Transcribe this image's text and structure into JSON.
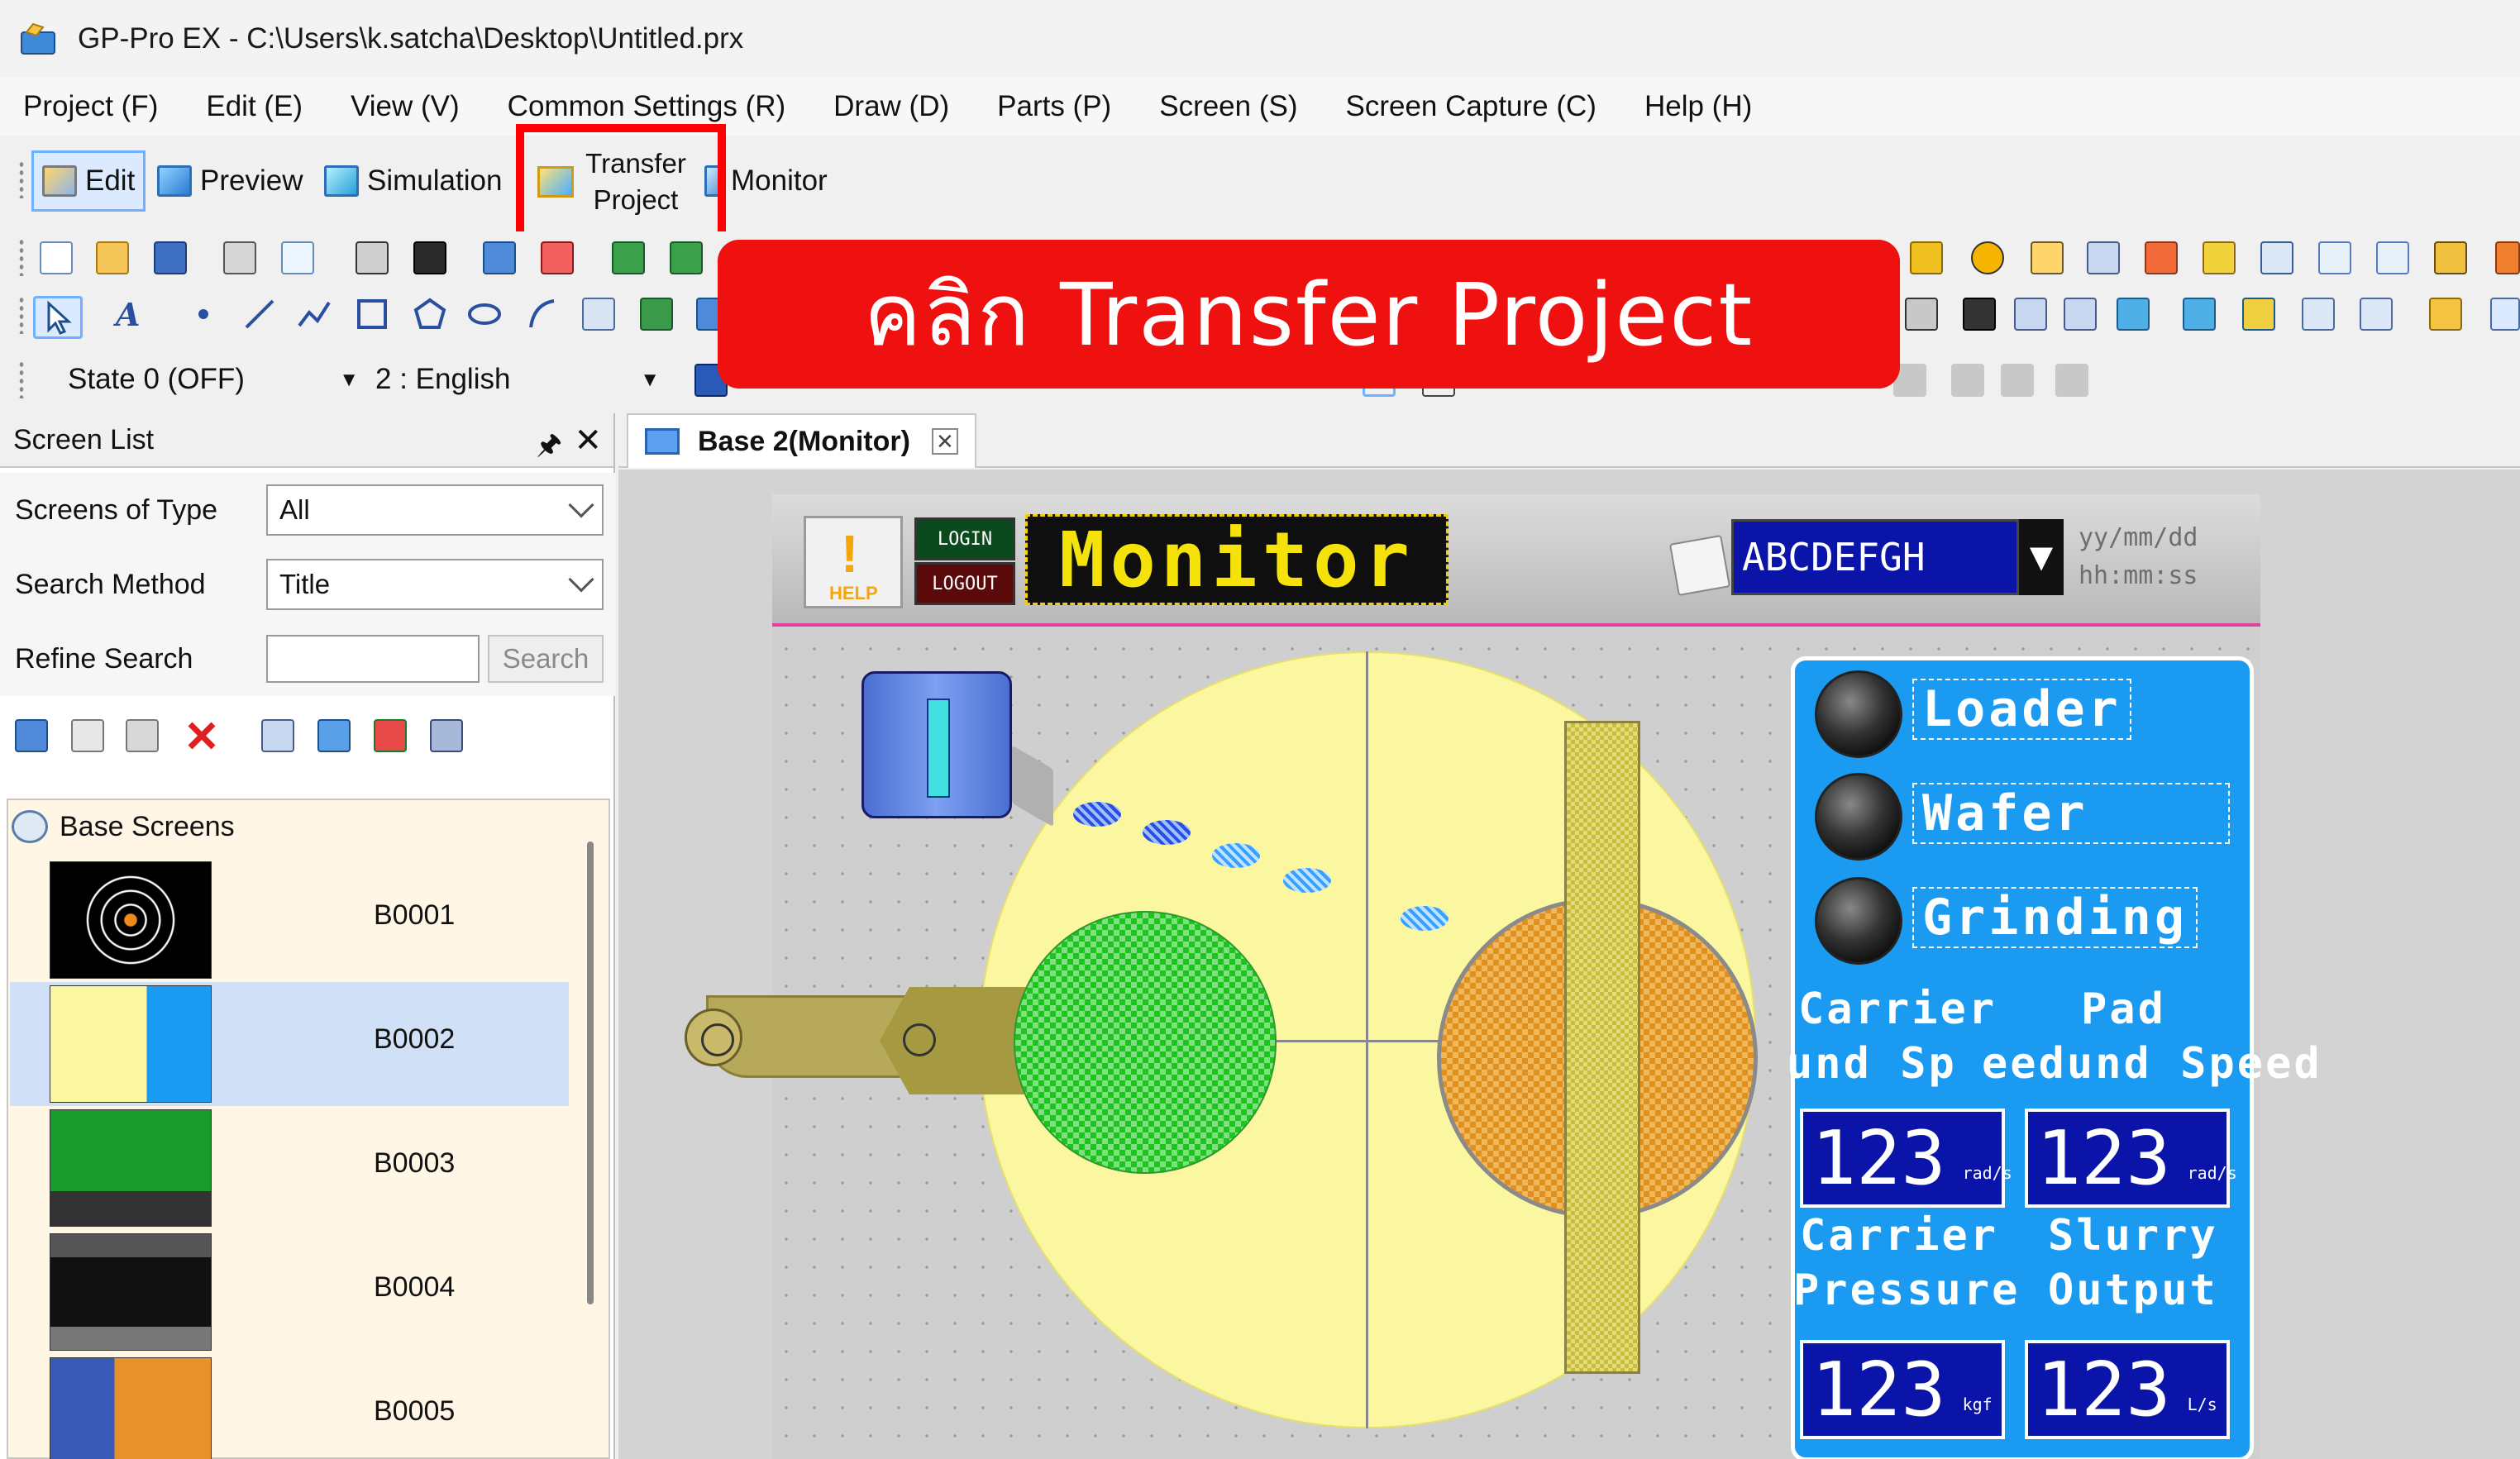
{
  "window": {
    "title": "GP-Pro EX - C:\\Users\\k.satcha\\Desktop\\Untitled.prx"
  },
  "menu": [
    "Project (F)",
    "Edit (E)",
    "View (V)",
    "Common Settings (R)",
    "Draw (D)",
    "Parts (P)",
    "Screen (S)",
    "Screen Capture (C)",
    "Help (H)"
  ],
  "modes": {
    "edit": "Edit",
    "preview": "Preview",
    "simulation": "Simulation",
    "transfer_line1": "Transfer",
    "transfer_line2": "Project",
    "monitor": "Monitor"
  },
  "combos": {
    "state": "State 0 (OFF)",
    "language": "2 : English"
  },
  "callout": {
    "text": "คลิก Transfer Project",
    "color": "#ef1010"
  },
  "screen_list": {
    "title": "Screen List",
    "screens_of_type_label": "Screens of Type",
    "screens_of_type_value": "All",
    "search_method_label": "Search Method",
    "search_method_value": "Title",
    "refine_search_label": "Refine Search",
    "search_button": "Search",
    "tree_root": "Base Screens",
    "items": [
      {
        "id": "B0001",
        "selected": false
      },
      {
        "id": "B0002",
        "selected": true
      },
      {
        "id": "B0003",
        "selected": false
      },
      {
        "id": "B0004",
        "selected": false
      },
      {
        "id": "B0005",
        "selected": false
      }
    ]
  },
  "tab": {
    "label": "Base 2(Monitor)"
  },
  "hmi": {
    "help": "HELP",
    "login": "LOGIN",
    "logout": "LOGOUT",
    "title": "Monitor",
    "message": "ABCDEFGH",
    "date": "yy/mm/dd",
    "time": "hh:mm:ss",
    "lamps": [
      "Loader",
      "Wafer",
      "Grinding"
    ],
    "label_carrier_speed_1": "Carrier",
    "label_carrier_speed_2": "und Sp",
    "label_pad_speed_1": "Pad",
    "label_pad_speed_2": "eedund Speed",
    "label_carrier_pressure_1": "Carrier",
    "label_carrier_pressure_2": "Pressure",
    "label_slurry_output_1": "Slurry",
    "label_slurry_output_2": "Output",
    "values": [
      {
        "value": "123",
        "unit": "rad/s"
      },
      {
        "value": "123",
        "unit": "rad/s"
      },
      {
        "value": "123",
        "unit": "kgf"
      },
      {
        "value": "123",
        "unit": "L/s"
      }
    ]
  }
}
